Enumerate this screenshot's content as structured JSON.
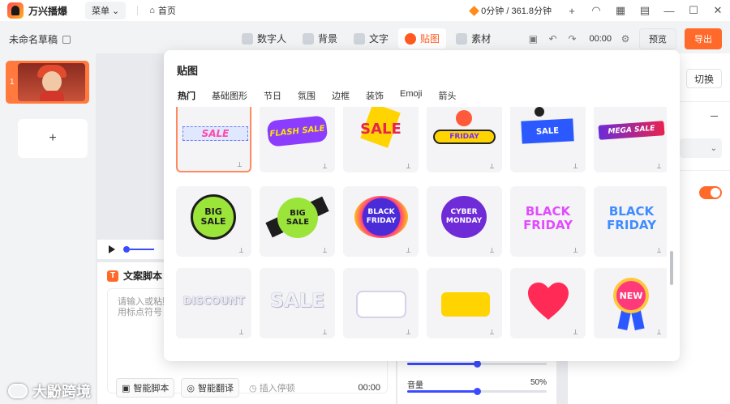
{
  "app": {
    "name": "万兴播爆"
  },
  "titlebar": {
    "menu_label": "菜单",
    "home_label": "首页",
    "quota": "0分钟 / 361.8分钟"
  },
  "toolbar": {
    "draft_name": "未命名草稿",
    "tools": [
      {
        "label": "数字人",
        "icon": "digital-human-icon"
      },
      {
        "label": "背景",
        "icon": "background-icon"
      },
      {
        "label": "文字",
        "icon": "text-icon"
      },
      {
        "label": "贴图",
        "icon": "sticker-icon"
      },
      {
        "label": "素材",
        "icon": "material-icon"
      }
    ],
    "active_tool": "贴图",
    "timecode": "00:00",
    "preview_label": "预览",
    "export_label": "导出"
  },
  "slides": {
    "items": [
      {
        "number": "1"
      }
    ],
    "add_label": "+"
  },
  "sticker_panel": {
    "title": "贴图",
    "tabs": [
      "热门",
      "基础图形",
      "节日",
      "氛围",
      "边框",
      "装饰",
      "Emoji",
      "箭头"
    ],
    "active_tab": "热门",
    "stickers": [
      {
        "name": "sale-banner",
        "text": "SALE"
      },
      {
        "name": "flash-sale",
        "text": "FLASH SALE"
      },
      {
        "name": "sale-burst",
        "text": "SALE"
      },
      {
        "name": "friday",
        "text": "FRIDAY"
      },
      {
        "name": "sale-tag",
        "text": "SALE"
      },
      {
        "name": "mega-sale",
        "text": "MEGA SALE"
      },
      {
        "name": "big-sale-badge",
        "text": "BIG SALE"
      },
      {
        "name": "big-sale-candy",
        "text": "BIG SALE"
      },
      {
        "name": "black-friday-circle",
        "text": "BLACK FRIDAY"
      },
      {
        "name": "cyber-monday",
        "text": "CYBER MONDAY"
      },
      {
        "name": "black-friday-pink",
        "text": "BLACK FRIDAY"
      },
      {
        "name": "black-friday-blue",
        "text": "BLACK FRIDAY"
      },
      {
        "name": "discount",
        "text": "DISCOUNT"
      },
      {
        "name": "sale-outline",
        "text": "SALE"
      },
      {
        "name": "white-button",
        "text": ""
      },
      {
        "name": "yellow-button",
        "text": ""
      },
      {
        "name": "heart",
        "text": ""
      },
      {
        "name": "new-ribbon",
        "text": "NEW"
      }
    ]
  },
  "right_panel": {
    "switch_label": "切换"
  },
  "script": {
    "title": "文案脚本",
    "placeholder": "请输入或粘贴用标点符号",
    "smart_script": "智能脚本",
    "smart_translate": "智能翻译",
    "insert_pause": "插入停顿",
    "time": "00:00"
  },
  "audio": {
    "volume_label": "音量",
    "volume_value": "50%"
  },
  "watermark": {
    "text": "大鼢跨境"
  },
  "colors": {
    "accent": "#ff6a2a",
    "progress": "#3b4bff"
  }
}
